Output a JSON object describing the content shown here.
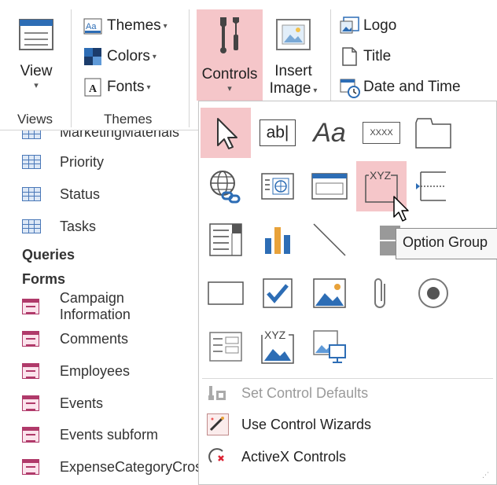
{
  "ribbon": {
    "view": {
      "label": "View",
      "caret": "▾",
      "group": "Views"
    },
    "themes": {
      "items": [
        "Themes",
        "Colors",
        "Fonts"
      ],
      "caret": "▾",
      "group": "Themes"
    },
    "controls": {
      "label": "Controls",
      "caret": "▾"
    },
    "insert_image": {
      "line1": "Insert",
      "line2": "Image",
      "caret": "▾"
    },
    "header": {
      "items": [
        "Logo",
        "Title",
        "Date and Time"
      ]
    }
  },
  "nav": {
    "top_cut": "MarketingMaterials",
    "tables": [
      "Priority",
      "Status",
      "Tasks"
    ],
    "queries_header": "Queries",
    "forms_header": "Forms",
    "forms": [
      "Campaign Information",
      "Comments",
      "Employees",
      "Events",
      "Events subform",
      "ExpenseCategoryCrosstab"
    ]
  },
  "dropdown": {
    "text_box_label": "ab|",
    "label_glyph": "Aa",
    "nav_ctrl_label": "XXXX",
    "option_group_label": "XYZ",
    "chart_label": "XYZ",
    "menu": [
      {
        "label": "Set Control Defaults",
        "disabled": true,
        "icon": "set-defaults-icon"
      },
      {
        "label": "Use Control Wizards",
        "disabled": false,
        "icon": "wand-icon"
      },
      {
        "label": "ActiveX Controls",
        "disabled": false,
        "icon": "activex-icon"
      }
    ]
  },
  "tooltip": {
    "text": "Option Group"
  },
  "colors": {
    "accent_pink": "#f5c6c9",
    "access_table_blue": "#4a78b8",
    "access_form_maroon": "#b03a6a"
  }
}
